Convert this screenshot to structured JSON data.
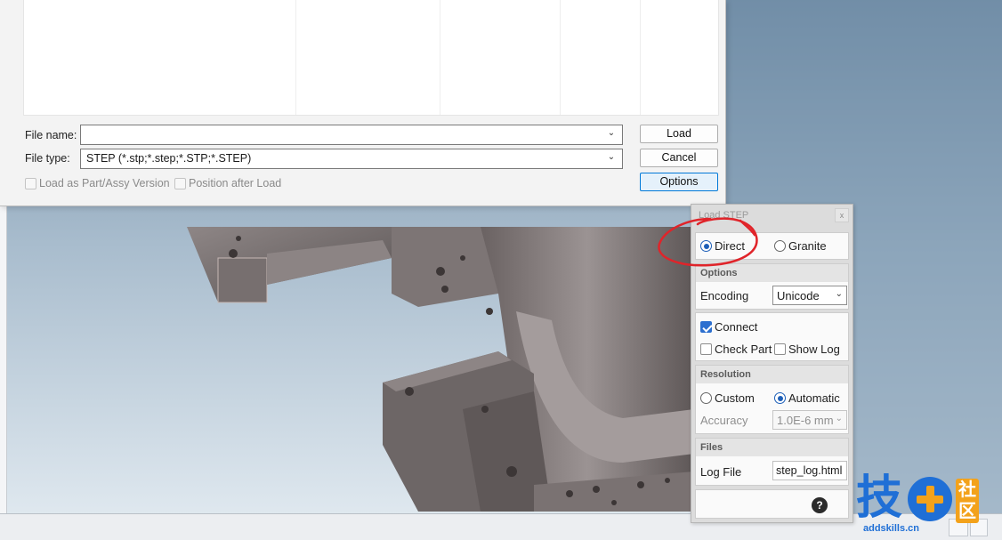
{
  "file_dialog": {
    "file_name_label": "File name:",
    "file_name_value": "",
    "file_type_label": "File type:",
    "file_type_value": "STEP (*.stp;*.step;*.STP;*.STEP)",
    "load_button": "Load",
    "cancel_button": "Cancel",
    "options_button": "Options",
    "load_as_part_label": "Load as Part/Assy Version",
    "position_after_load_label": "Position after Load"
  },
  "load_step": {
    "title": "Load STEP",
    "close_glyph": "x",
    "mode_direct": "Direct",
    "mode_granite": "Granite",
    "options_header": "Options",
    "encoding_label": "Encoding",
    "encoding_value": "Unicode",
    "connect_label": "Connect",
    "check_part_label": "Check Part",
    "show_log_label": "Show Log",
    "resolution_header": "Resolution",
    "custom_label": "Custom",
    "automatic_label": "Automatic",
    "accuracy_label": "Accuracy",
    "accuracy_value": "1.0E-6 mm",
    "files_header": "Files",
    "log_file_label": "Log File",
    "log_file_value": "step_log.html",
    "help_glyph": "?"
  },
  "watermark": {
    "char1": "技",
    "char2": "社",
    "char3": "区",
    "url": "addskills.cn"
  },
  "colors": {
    "accent": "#1d5fb8",
    "annotation": "#e0242a",
    "watermark_blue": "#1f6fd6",
    "watermark_orange": "#f3a21b"
  }
}
